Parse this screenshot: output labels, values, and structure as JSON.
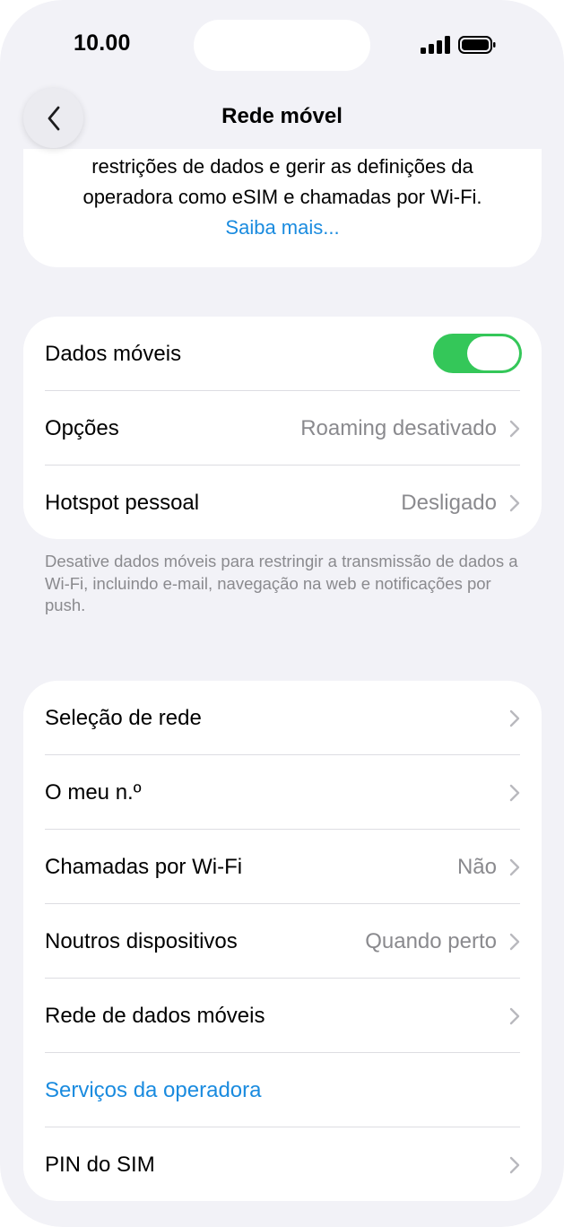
{
  "status_bar": {
    "time": "10.00"
  },
  "nav": {
    "title": "Rede móvel",
    "back_icon": "chevron-left-icon"
  },
  "info": {
    "line1": "restrições de dados e gerir as definições da",
    "line2": "operadora como eSIM e chamadas por Wi-Fi.",
    "link": "Saiba mais..."
  },
  "group1": {
    "mobile_data": {
      "label": "Dados móveis",
      "toggle_on": true
    },
    "options": {
      "label": "Opções",
      "value": "Roaming desativado"
    },
    "hotspot": {
      "label": "Hotspot pessoal",
      "value": "Desligado"
    },
    "footnote": "Desative dados móveis para restringir a transmissão de dados a Wi-Fi, incluindo e-mail, navegação na web e notificações por push."
  },
  "group2": {
    "network_selection": {
      "label": "Seleção de rede"
    },
    "my_number": {
      "label": "O meu n.º"
    },
    "wifi_calling": {
      "label": "Chamadas por Wi-Fi",
      "value": "Não"
    },
    "other_devices": {
      "label": "Noutros dispositivos",
      "value": "Quando perto"
    },
    "mobile_data_network": {
      "label": "Rede de dados móveis"
    },
    "carrier_services": {
      "label": "Serviços da operadora"
    },
    "sim_pin": {
      "label": "PIN do SIM"
    }
  },
  "colors": {
    "background": "#F2F2F7",
    "card": "#FFFFFF",
    "accent": "#1A8BDF",
    "toggle_on": "#34C759",
    "secondary_text": "#8A8A8E"
  }
}
